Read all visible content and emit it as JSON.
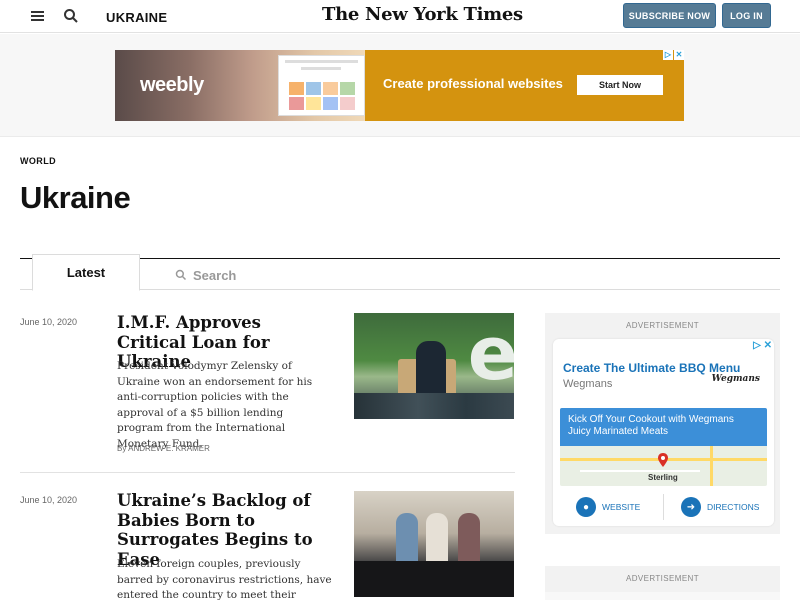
{
  "topbar": {
    "section": "UKRAINE",
    "masthead": "The New York Times",
    "subscribe_label": "SUBSCRIBE NOW",
    "login_label": "LOG IN",
    "accent_color": "#567b95"
  },
  "banner_ad": {
    "brand": "weebly",
    "tagline": "Create professional websites",
    "cta": "Start Now",
    "bg_color": "#d4930f"
  },
  "page": {
    "kicker": "WORLD",
    "title": "Ukraine"
  },
  "tabs": {
    "latest": "Latest",
    "search": "Search"
  },
  "articles": [
    {
      "date": "June 10, 2020",
      "headline": "I.M.F. Approves Critical Loan for Ukraine",
      "summary": "President Volodymyr Zelensky of Ukraine won an endorsement for his anti-corruption policies with the approval of a $5 billion lending program from the International Monetary Fund.",
      "byline": "By ANDREW E. KRAMER"
    },
    {
      "date": "June 10, 2020",
      "headline": "Ukraine’s Backlog of Babies Born to Surrogates Begins to Ease",
      "summary": "Eleven foreign couples, previously barred by coronavirus restrictions, have entered the country to meet their newborns. But"
    }
  ],
  "sidebar": {
    "ad_label": "ADVERTISEMENT",
    "wegmans": {
      "title": "Create The Ultimate BBQ Menu",
      "brand": "Wegmans",
      "logo": "Wegmans",
      "banner": "Kick Off Your Cookout with Wegmans Juicy Marinated Meats",
      "city": "Sterling",
      "website_label": "WEBSITE",
      "directions_label": "DIRECTIONS"
    },
    "ad_label_2": "ADVERTISEMENT"
  }
}
